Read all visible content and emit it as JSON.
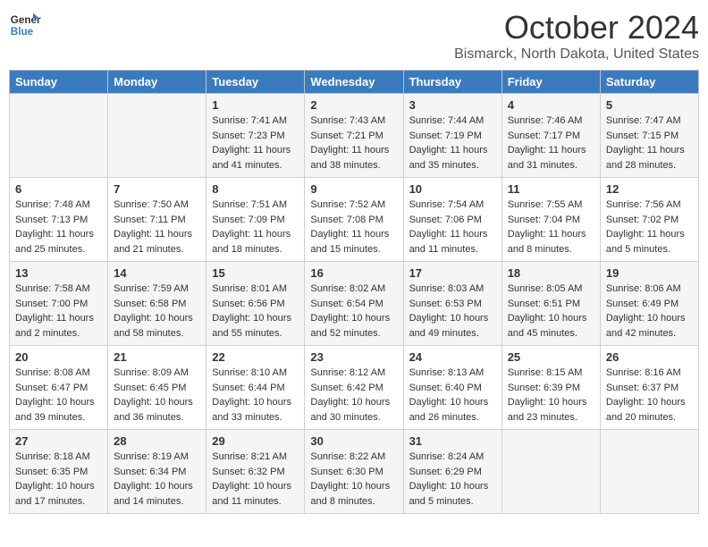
{
  "header": {
    "logo_line1": "General",
    "logo_line2": "Blue",
    "month": "October 2024",
    "location": "Bismarck, North Dakota, United States"
  },
  "days_of_week": [
    "Sunday",
    "Monday",
    "Tuesday",
    "Wednesday",
    "Thursday",
    "Friday",
    "Saturday"
  ],
  "weeks": [
    [
      {
        "day": "",
        "detail": ""
      },
      {
        "day": "",
        "detail": ""
      },
      {
        "day": "1",
        "detail": "Sunrise: 7:41 AM\nSunset: 7:23 PM\nDaylight: 11 hours and 41 minutes."
      },
      {
        "day": "2",
        "detail": "Sunrise: 7:43 AM\nSunset: 7:21 PM\nDaylight: 11 hours and 38 minutes."
      },
      {
        "day": "3",
        "detail": "Sunrise: 7:44 AM\nSunset: 7:19 PM\nDaylight: 11 hours and 35 minutes."
      },
      {
        "day": "4",
        "detail": "Sunrise: 7:46 AM\nSunset: 7:17 PM\nDaylight: 11 hours and 31 minutes."
      },
      {
        "day": "5",
        "detail": "Sunrise: 7:47 AM\nSunset: 7:15 PM\nDaylight: 11 hours and 28 minutes."
      }
    ],
    [
      {
        "day": "6",
        "detail": "Sunrise: 7:48 AM\nSunset: 7:13 PM\nDaylight: 11 hours and 25 minutes."
      },
      {
        "day": "7",
        "detail": "Sunrise: 7:50 AM\nSunset: 7:11 PM\nDaylight: 11 hours and 21 minutes."
      },
      {
        "day": "8",
        "detail": "Sunrise: 7:51 AM\nSunset: 7:09 PM\nDaylight: 11 hours and 18 minutes."
      },
      {
        "day": "9",
        "detail": "Sunrise: 7:52 AM\nSunset: 7:08 PM\nDaylight: 11 hours and 15 minutes."
      },
      {
        "day": "10",
        "detail": "Sunrise: 7:54 AM\nSunset: 7:06 PM\nDaylight: 11 hours and 11 minutes."
      },
      {
        "day": "11",
        "detail": "Sunrise: 7:55 AM\nSunset: 7:04 PM\nDaylight: 11 hours and 8 minutes."
      },
      {
        "day": "12",
        "detail": "Sunrise: 7:56 AM\nSunset: 7:02 PM\nDaylight: 11 hours and 5 minutes."
      }
    ],
    [
      {
        "day": "13",
        "detail": "Sunrise: 7:58 AM\nSunset: 7:00 PM\nDaylight: 11 hours and 2 minutes."
      },
      {
        "day": "14",
        "detail": "Sunrise: 7:59 AM\nSunset: 6:58 PM\nDaylight: 10 hours and 58 minutes."
      },
      {
        "day": "15",
        "detail": "Sunrise: 8:01 AM\nSunset: 6:56 PM\nDaylight: 10 hours and 55 minutes."
      },
      {
        "day": "16",
        "detail": "Sunrise: 8:02 AM\nSunset: 6:54 PM\nDaylight: 10 hours and 52 minutes."
      },
      {
        "day": "17",
        "detail": "Sunrise: 8:03 AM\nSunset: 6:53 PM\nDaylight: 10 hours and 49 minutes."
      },
      {
        "day": "18",
        "detail": "Sunrise: 8:05 AM\nSunset: 6:51 PM\nDaylight: 10 hours and 45 minutes."
      },
      {
        "day": "19",
        "detail": "Sunrise: 8:06 AM\nSunset: 6:49 PM\nDaylight: 10 hours and 42 minutes."
      }
    ],
    [
      {
        "day": "20",
        "detail": "Sunrise: 8:08 AM\nSunset: 6:47 PM\nDaylight: 10 hours and 39 minutes."
      },
      {
        "day": "21",
        "detail": "Sunrise: 8:09 AM\nSunset: 6:45 PM\nDaylight: 10 hours and 36 minutes."
      },
      {
        "day": "22",
        "detail": "Sunrise: 8:10 AM\nSunset: 6:44 PM\nDaylight: 10 hours and 33 minutes."
      },
      {
        "day": "23",
        "detail": "Sunrise: 8:12 AM\nSunset: 6:42 PM\nDaylight: 10 hours and 30 minutes."
      },
      {
        "day": "24",
        "detail": "Sunrise: 8:13 AM\nSunset: 6:40 PM\nDaylight: 10 hours and 26 minutes."
      },
      {
        "day": "25",
        "detail": "Sunrise: 8:15 AM\nSunset: 6:39 PM\nDaylight: 10 hours and 23 minutes."
      },
      {
        "day": "26",
        "detail": "Sunrise: 8:16 AM\nSunset: 6:37 PM\nDaylight: 10 hours and 20 minutes."
      }
    ],
    [
      {
        "day": "27",
        "detail": "Sunrise: 8:18 AM\nSunset: 6:35 PM\nDaylight: 10 hours and 17 minutes."
      },
      {
        "day": "28",
        "detail": "Sunrise: 8:19 AM\nSunset: 6:34 PM\nDaylight: 10 hours and 14 minutes."
      },
      {
        "day": "29",
        "detail": "Sunrise: 8:21 AM\nSunset: 6:32 PM\nDaylight: 10 hours and 11 minutes."
      },
      {
        "day": "30",
        "detail": "Sunrise: 8:22 AM\nSunset: 6:30 PM\nDaylight: 10 hours and 8 minutes."
      },
      {
        "day": "31",
        "detail": "Sunrise: 8:24 AM\nSunset: 6:29 PM\nDaylight: 10 hours and 5 minutes."
      },
      {
        "day": "",
        "detail": ""
      },
      {
        "day": "",
        "detail": ""
      }
    ]
  ]
}
